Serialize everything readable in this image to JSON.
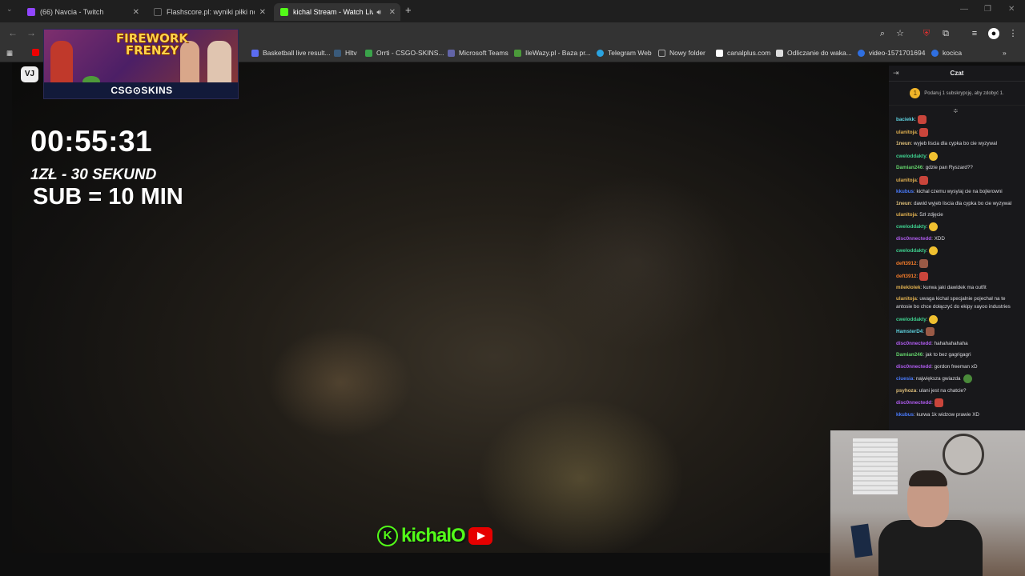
{
  "browser": {
    "tabs": [
      {
        "label": "(66) Navcia - Twitch",
        "favicon_color": "#9146ff",
        "active": false
      },
      {
        "label": "Flashscore.pl: wyniki piłki nożnej",
        "favicon_color": "#1e1e1e",
        "active": false
      },
      {
        "label": "kichal Stream - Watch Live",
        "favicon_color": "#53fc18",
        "active": true
      }
    ],
    "new_tab_label": "+",
    "bookmarks": [
      {
        "label": "Basketball live result...",
        "color": "#5b6cf0"
      },
      {
        "label": "Hltv",
        "color": "#3a5a7a"
      },
      {
        "label": "Orrti - CSGO-SKINS...",
        "color": "#3aa34a"
      },
      {
        "label": "Microsoft Teams",
        "color": "#6264a7"
      },
      {
        "label": "IleWazy.pl - Baza pr...",
        "color": "#4b9a3a"
      },
      {
        "label": "Telegram Web",
        "color": "#2aa3e0"
      },
      {
        "label": "Nowy folder",
        "color": "#aaaaaa"
      },
      {
        "label": "canalplus.com",
        "color": "#ffffff"
      },
      {
        "label": "Odliczanie do waka...",
        "color": "#dddddd"
      },
      {
        "label": "video-1571701694",
        "color": "#2f6fe0"
      },
      {
        "label": "kocica",
        "color": "#2f6fe0"
      }
    ]
  },
  "overlay": {
    "promo_title": "FIREWORK FRENZY",
    "promo_brand": "CSG⊙SKINS",
    "vj_badge": "VJ",
    "timer": "00:55:31",
    "rate_line": "1ZŁ - 30 SEKUND",
    "sub_line": "SUB = 10 MIN",
    "logo_k": "K",
    "logo_name": "kichalO"
  },
  "chat": {
    "title": "Czat",
    "gift_text": "Podaruj 1 subskrypcję, aby zdobyć 1.",
    "gift_coin": "1",
    "messages": [
      {
        "user": "baciekk",
        "color": "#5fd3e0",
        "text": "",
        "emote": "red"
      },
      {
        "user": "ulanitoja",
        "color": "#e0b050",
        "text": "",
        "emote": "red"
      },
      {
        "user": "1neun",
        "color": "#e0c07a",
        "text": "wyjeb liscia dla cypka bo cie wyzywal",
        "emote": ""
      },
      {
        "user": "cweloddakty",
        "color": "#3ecf8e",
        "text": "",
        "emote": "yellow"
      },
      {
        "user": "Damian246",
        "color": "#63d36b",
        "text": "gdzie pan Ryszard??",
        "emote": ""
      },
      {
        "user": "ulanitoja",
        "color": "#e0b050",
        "text": "",
        "emote": "red"
      },
      {
        "user": "kkubus",
        "color": "#4a7cff",
        "text": "kichal czemu wysylaj cie na bojlerowni",
        "emote": ""
      },
      {
        "user": "1neun",
        "color": "#e0c07a",
        "text": "dawid wyjeb liscia dla cypka bo cie wyzywal",
        "emote": ""
      },
      {
        "user": "ulanitoja",
        "color": "#e0b050",
        "text": "5zł zdjęcie",
        "emote": ""
      },
      {
        "user": "cweloddakty",
        "color": "#3ecf8e",
        "text": "",
        "emote": "yellow"
      },
      {
        "user": "disc0nnectedd",
        "color": "#b05cf0",
        "text": "XDD",
        "emote": ""
      },
      {
        "user": "cweloddakty",
        "color": "#3ecf8e",
        "text": "",
        "emote": "yellow"
      },
      {
        "user": "deft3912",
        "color": "#f07a2a",
        "text": "",
        "emote": "face"
      },
      {
        "user": "deft3912",
        "color": "#f07a2a",
        "text": "",
        "emote": "red"
      },
      {
        "user": "mileklolek",
        "color": "#e0b050",
        "text": "kurwa jaki dawidek ma outfit",
        "emote": ""
      },
      {
        "user": "ulanitoja",
        "color": "#e0b050",
        "text": "uwaga kichal specjalnie pojechał na te antosie bo chce dołączyć do ekipy xayoo industries",
        "emote": ""
      },
      {
        "user": "cweloddakty",
        "color": "#3ecf8e",
        "text": "",
        "emote": "yellow"
      },
      {
        "user": "HamsterD4",
        "color": "#5fd3e0",
        "text": "",
        "emote": "face"
      },
      {
        "user": "disc0nnectedd",
        "color": "#b05cf0",
        "text": "hahahahahaha",
        "emote": ""
      },
      {
        "user": "Damian246",
        "color": "#63d36b",
        "text": "jak to bez gagrigagri",
        "emote": ""
      },
      {
        "user": "disc0nnectedd",
        "color": "#b05cf0",
        "text": "gordon freeman xD",
        "emote": ""
      },
      {
        "user": "ciuesia",
        "color": "#4a7cff",
        "text": "największa gwiazda",
        "emote": "green"
      },
      {
        "user": "psyhoza",
        "color": "#e0c07a",
        "text": "ulani jest na chatcie?",
        "emote": ""
      },
      {
        "user": "disc0nnectedd",
        "color": "#b05cf0",
        "text": "",
        "emote": "red"
      },
      {
        "user": "kkubus",
        "color": "#4a7cff",
        "text": "kurwa 1k widzow prawie XD",
        "emote": ""
      }
    ]
  }
}
